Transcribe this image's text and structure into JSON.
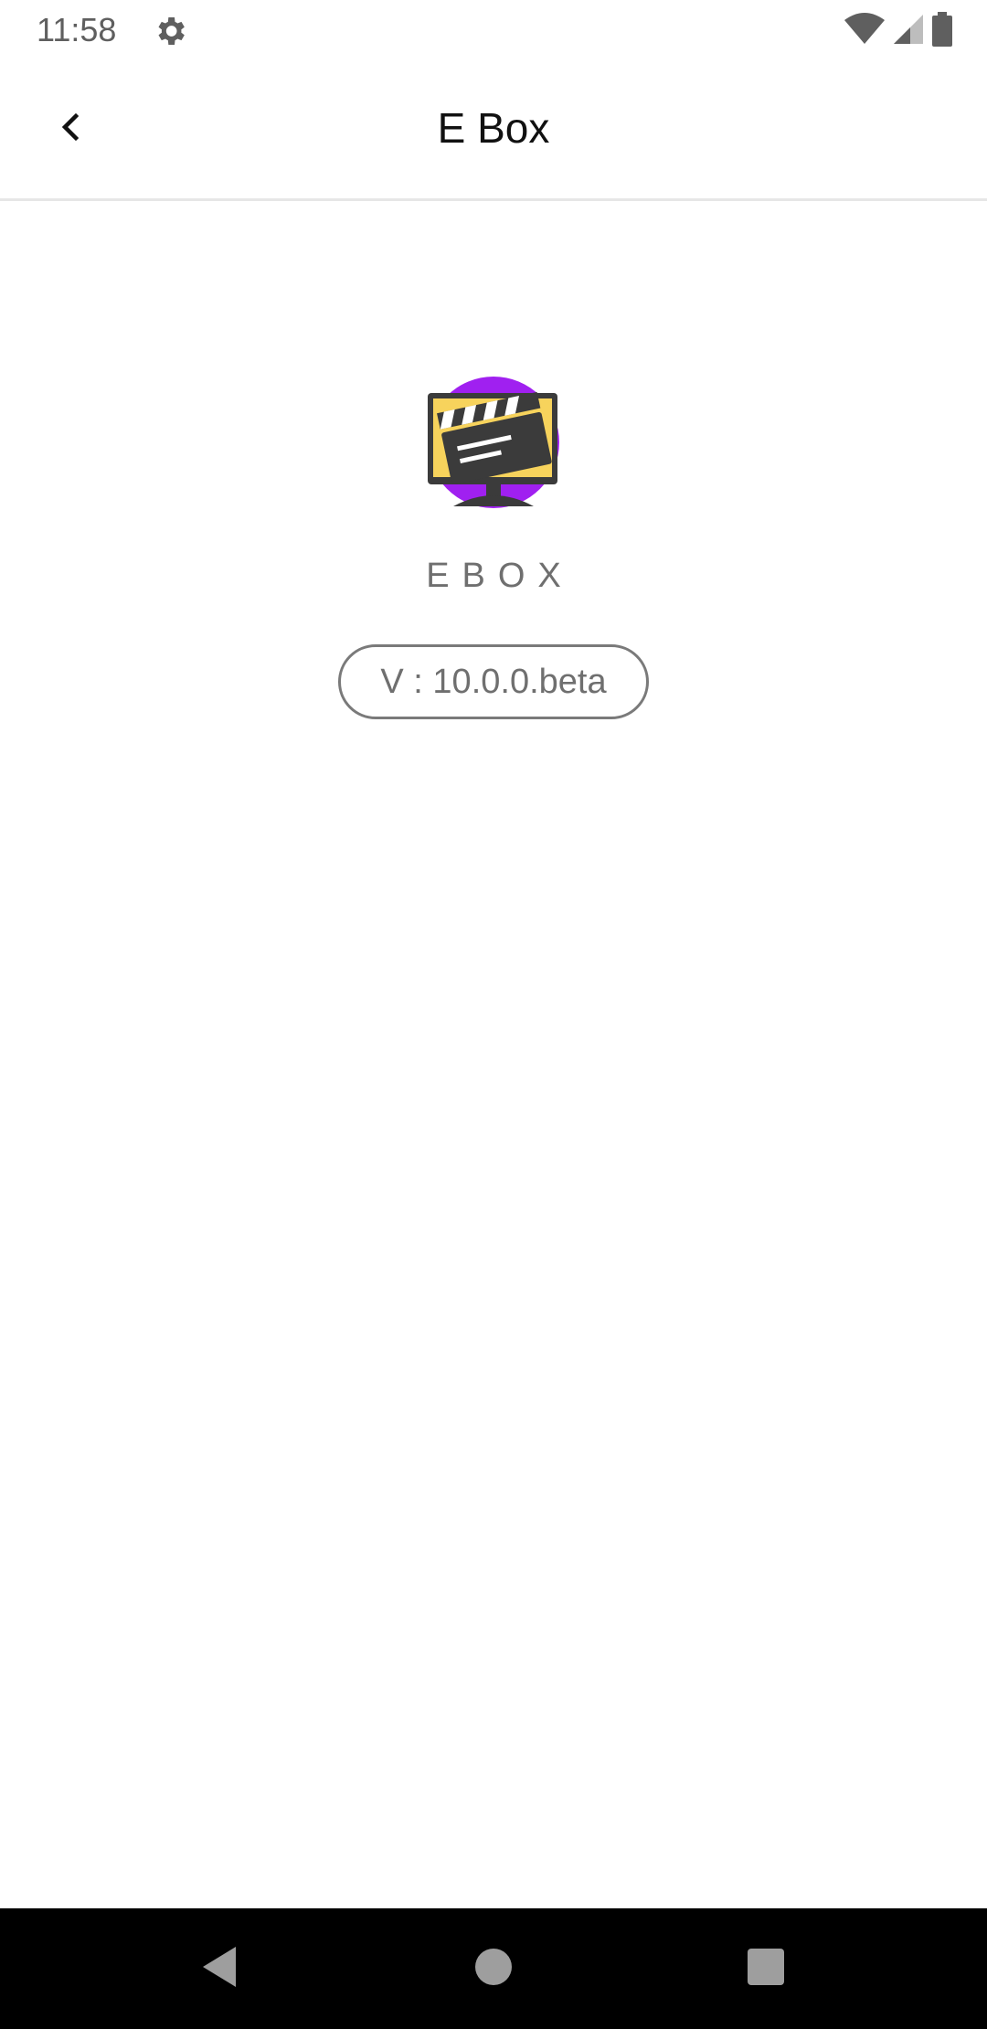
{
  "status_bar": {
    "time": "11:58",
    "icons": [
      "gear-icon",
      "wifi-icon",
      "cell-signal-icon",
      "battery-icon"
    ]
  },
  "app_bar": {
    "title": "E Box",
    "back_icon": "chevron-left-icon"
  },
  "about": {
    "logo_icon": "clapperboard-app-icon",
    "app_name": "EBOX",
    "version": "V : 10.0.0.beta"
  },
  "nav_bar": {
    "buttons": [
      "back-triangle-icon",
      "home-circle-icon",
      "recents-square-icon"
    ]
  },
  "colors": {
    "logo_circle": "#a020f0",
    "logo_screen": "#f7d35c",
    "logo_dark": "#3b3b3b",
    "status_gray": "#5f5f5f",
    "text_gray": "#6f6f6f"
  }
}
